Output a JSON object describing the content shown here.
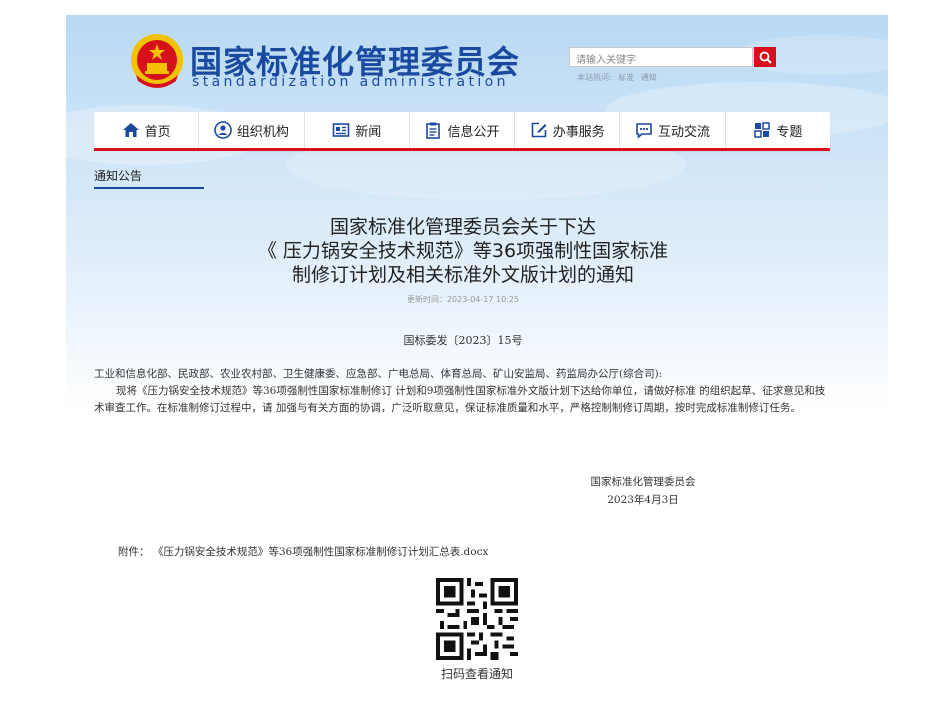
{
  "site": {
    "name_cn": "国家标准化管理委员会",
    "name_en": "standardization administration"
  },
  "search": {
    "placeholder": "请输入关键字",
    "hot_label": "本站热词:",
    "hot_terms": [
      "标准",
      "通知"
    ]
  },
  "nav": {
    "items": [
      {
        "label": "首页",
        "icon": "home-icon"
      },
      {
        "label": "组织机构",
        "icon": "person-circle-icon"
      },
      {
        "label": "新闻",
        "icon": "newspaper-icon"
      },
      {
        "label": "信息公开",
        "icon": "clipboard-icon"
      },
      {
        "label": "办事服务",
        "icon": "edit-icon"
      },
      {
        "label": "互动交流",
        "icon": "chat-icon"
      },
      {
        "label": "专题",
        "icon": "topic-icon"
      }
    ]
  },
  "breadcrumb": "通知公告",
  "article": {
    "title_lines": [
      "国家标准化管理委员会关于下达",
      "《 压力锅安全技术规范》等36项强制性国家标准",
      "制修订计划及相关标准外文版计划的通知"
    ],
    "updated": "更新时间：2023-04-17 10:25",
    "doc_number": "国标委发〔2023〕15号",
    "recipients": "工业和信息化部、民政部、农业农村部、卫生健康委、应急部、广电总局、体育总局、矿山安监局、药监局办公厅(综合司):",
    "body": "现将《压力锅安全技术规范》等36项强制性国家标准制修订 计划和9项强制性国家标准外文版计划下达给你单位，请做好标准 的组织起草、征求意见和技术审查工作。在标准制修订过程中，请 加强与有关方面的协调，广泛听取意见，保证标准质量和水平，严格控制制修订周期，按时完成标准制修订任务。",
    "signature_org": "国家标准化管理委员会",
    "signature_date": "2023年4月3日",
    "attachment_label": "附件：",
    "attachment_file": "《压力锅安全技术规范》等36项强制性国家标准制修订计划汇总表.docx"
  },
  "qr": {
    "caption": "扫码查看通知"
  },
  "colors": {
    "brand_blue": "#1a4aa0",
    "accent_red": "#d6111c"
  }
}
